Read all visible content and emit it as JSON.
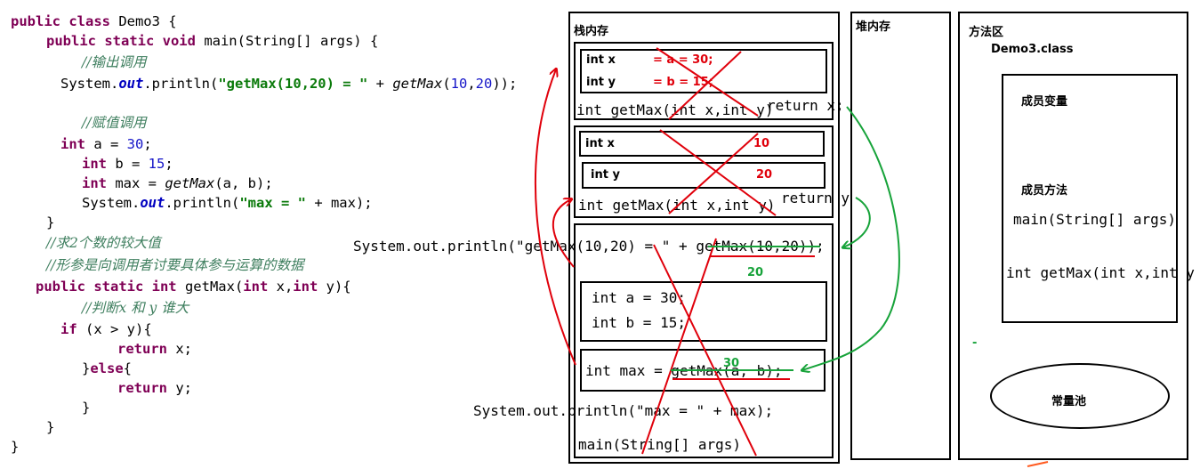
{
  "code": {
    "class_decl": {
      "kw": "public class",
      "rest": " Demo3 {"
    },
    "main_decl": {
      "kw": "public static void",
      "rest": " main(String[] args) {"
    },
    "comment_output_call": "//输出调用",
    "println1": {
      "pre": "System.",
      "field": "out",
      "mid": ".println(",
      "str": "\"getMax(10,20) = \"",
      "plus": " + ",
      "call": "getMax",
      "open": "(",
      "n1": "10",
      "comma": ",",
      "n2": "20",
      "close": "));"
    },
    "comment_assign_call": "//赋值调用",
    "decl_a": {
      "kw": "int",
      "rest": " a = ",
      "num": "30",
      "end": ";"
    },
    "decl_b": {
      "kw": "int",
      "rest": " b = ",
      "num": "15",
      "end": ";"
    },
    "decl_max": {
      "kw": "int",
      "rest": " max = ",
      "call": "getMax",
      "args": "(a, b);"
    },
    "println2": {
      "pre": "System.",
      "field": "out",
      "mid": ".println(",
      "str": "\"max = \"",
      "rest": " + max);"
    },
    "close_main": "}",
    "comment_task": "//求2个数的较大值",
    "comment_param": "//形参是向调用者讨要具体参与运算的数据",
    "getmax_decl": {
      "kw": "public static int",
      "rest": " getMax(",
      "kw2": "int",
      "mid": " x,",
      "kw3": "int",
      "end": " y){"
    },
    "comment_compare": "//判断x 和 y 谁大",
    "if_line": {
      "kw": "if",
      "rest": " (x > y){"
    },
    "return_x": {
      "kw": "return",
      "rest": " x;"
    },
    "else_line": {
      "pre": "}",
      "kw": "else",
      "rest": "{"
    },
    "return_y": {
      "kw": "return",
      "rest": " y;"
    },
    "close_if": "}",
    "close_method": "}",
    "close_class": "}"
  },
  "stack": {
    "title": "栈内存",
    "frame1": {
      "var_x": "int x",
      "val_x": "= a = 30;",
      "var_y": "int y",
      "val_y": "= b = 15;",
      "signature": "int getMax(int x,int y)",
      "return_text": "return x;"
    },
    "frame2": {
      "var_x": "int x",
      "val_x": "10",
      "var_y": "int y",
      "val_y": "20",
      "signature": "int getMax(int x,int y)",
      "return_text": "return y;"
    },
    "main_frame": {
      "println1": "System.out.println(\"getMax(10,20) = \" + getMax(10,20));",
      "result_20": "20",
      "line_a": "int a = 30;",
      "line_b": "int b = 15;",
      "line_max": "int max = getMax(a, b);",
      "result_30": "30",
      "println2": "System.out.println(\"max = \" + max);",
      "signature": "main(String[] args)"
    }
  },
  "heap": {
    "title": "堆内存"
  },
  "method_area": {
    "title": "方法区",
    "class_name": "Demo3.class",
    "members_label": "成员变量",
    "methods_label": "成员方法",
    "main_sig": "main(String[] args)",
    "getmax_sig": "int getMax(int x,int y",
    "constant_pool": "常量池",
    "dash_mark": "-"
  },
  "colors": {
    "red": "#e0000b",
    "green": "#17a33a",
    "keyword": "#7f0055",
    "number": "#1515c8"
  }
}
